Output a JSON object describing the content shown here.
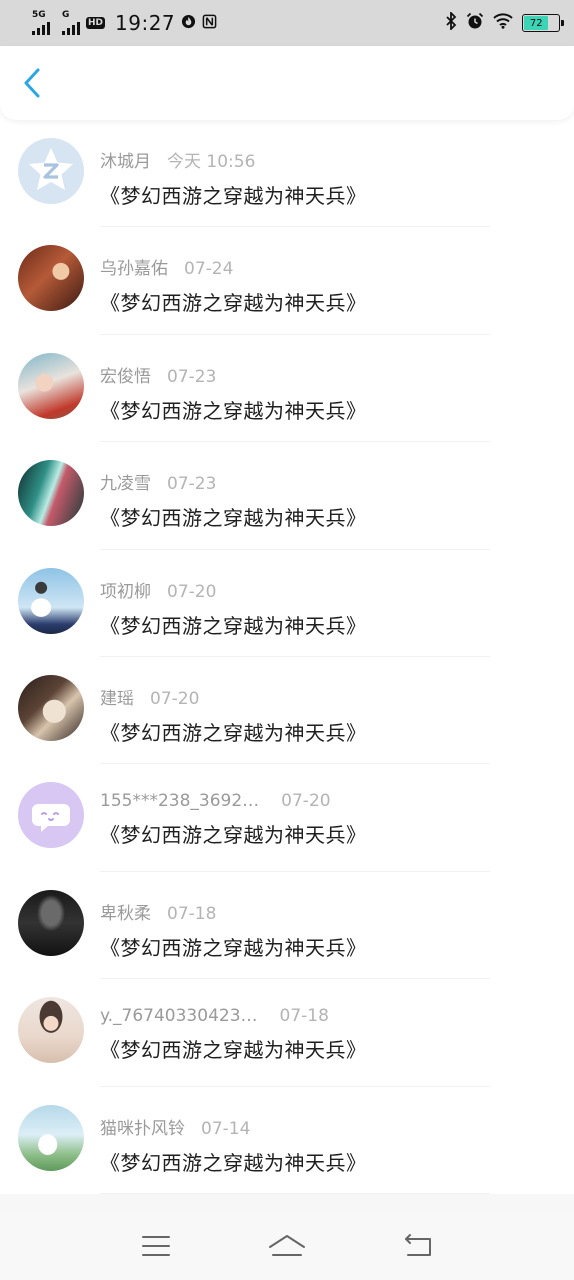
{
  "status_bar": {
    "network_1": "5G",
    "network_2": "G",
    "hd_badge": "HD",
    "time": "19:27",
    "battery_level": "72",
    "icons": [
      "signal-icon",
      "signal-icon",
      "hd-icon",
      "fire-icon",
      "nfc-icon",
      "bluetooth-icon",
      "alarm-icon",
      "wifi-icon",
      "battery-icon"
    ]
  },
  "header": {
    "back_icon": "chevron-left-icon",
    "accent_color": "#2aa6e6"
  },
  "messages": [
    {
      "name": "沐城月",
      "date": "今天 10:56",
      "title": "《梦幻西游之穿越为神天兵》",
      "avatar": "default-z-avatar"
    },
    {
      "name": "乌孙嘉佑",
      "date": "07-24",
      "title": "《梦幻西游之穿越为神天兵》",
      "avatar": "photo-avatar"
    },
    {
      "name": "宏俊悟",
      "date": "07-23",
      "title": "《梦幻西游之穿越为神天兵》",
      "avatar": "photo-avatar"
    },
    {
      "name": "九凌雪",
      "date": "07-23",
      "title": "《梦幻西游之穿越为神天兵》",
      "avatar": "photo-avatar"
    },
    {
      "name": "项初柳",
      "date": "07-20",
      "title": "《梦幻西游之穿越为神天兵》",
      "avatar": "photo-avatar"
    },
    {
      "name": "建瑶",
      "date": "07-20",
      "title": "《梦幻西游之穿越为神天兵》",
      "avatar": "photo-avatar"
    },
    {
      "name": "155***238_3692…",
      "date": "07-20",
      "title": "《梦幻西游之穿越为神天兵》",
      "avatar": "chat-bubble-avatar"
    },
    {
      "name": "卑秋柔",
      "date": "07-18",
      "title": "《梦幻西游之穿越为神天兵》",
      "avatar": "photo-avatar"
    },
    {
      "name": "y._76740330423…",
      "date": "07-18",
      "title": "《梦幻西游之穿越为神天兵》",
      "avatar": "photo-avatar"
    },
    {
      "name": "猫咪扑风铃",
      "date": "07-14",
      "title": "《梦幻西游之穿越为神天兵》",
      "avatar": "photo-avatar"
    }
  ],
  "nav_bar": {
    "icons": [
      "menu-icon",
      "home-icon",
      "back-icon"
    ]
  }
}
